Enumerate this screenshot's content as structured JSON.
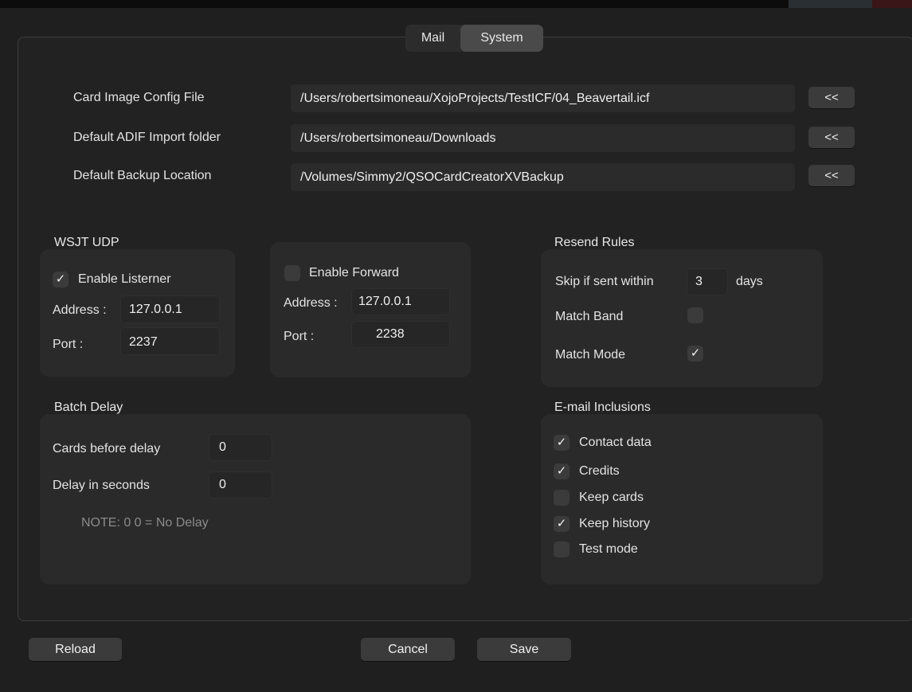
{
  "tabs": [
    {
      "label": "Mail"
    },
    {
      "label": "System"
    }
  ],
  "paths": {
    "card_image": {
      "label": "Card Image Config File",
      "value": "/Users/robertsimoneau/XojoProjects/TestICF/04_Beavertail.icf",
      "browse_label": "<<"
    },
    "adif_import": {
      "label": "Default ADIF Import  folder",
      "value": "/Users/robertsimoneau/Downloads",
      "browse_label": "<<"
    },
    "backup": {
      "label": "Default Backup Location",
      "value": "/Volumes/Simmy2/QSOCardCreatorXVBackup",
      "browse_label": "<<"
    }
  },
  "wsjt": {
    "heading": "WSJT UDP",
    "listener": {
      "label": "Enable Listerner",
      "checked": true,
      "address_label": "Address :",
      "address": "127.0.0.1",
      "port_label": "Port :",
      "port": "2237"
    },
    "forward": {
      "label": "Enable Forward",
      "checked": false,
      "address_label": "Address :",
      "address": "127.0.0.1",
      "port_label": "Port :",
      "port": "2238"
    }
  },
  "resend": {
    "heading": "Resend Rules",
    "skip_label": "Skip if sent within",
    "skip_value": "3",
    "skip_unit": "days",
    "match_band": {
      "label": "Match Band",
      "checked": false
    },
    "match_mode": {
      "label": "Match Mode",
      "checked": true
    }
  },
  "batch": {
    "heading": "Batch Delay",
    "cards_label": "Cards before delay",
    "cards_value": "0",
    "delay_label": "Delay in seconds",
    "delay_value": "0",
    "note": "NOTE: 0  0 = No Delay"
  },
  "email": {
    "heading": "E-mail Inclusions",
    "items": [
      {
        "label": "Contact data",
        "checked": true
      },
      {
        "label": "Credits",
        "checked": true
      },
      {
        "label": "Keep cards",
        "checked": false
      },
      {
        "label": "Keep history",
        "checked": true
      },
      {
        "label": "Test mode",
        "checked": false
      }
    ]
  },
  "buttons": {
    "reload": "Reload",
    "cancel": "Cancel",
    "save": "Save"
  },
  "check_glyph": "✓"
}
